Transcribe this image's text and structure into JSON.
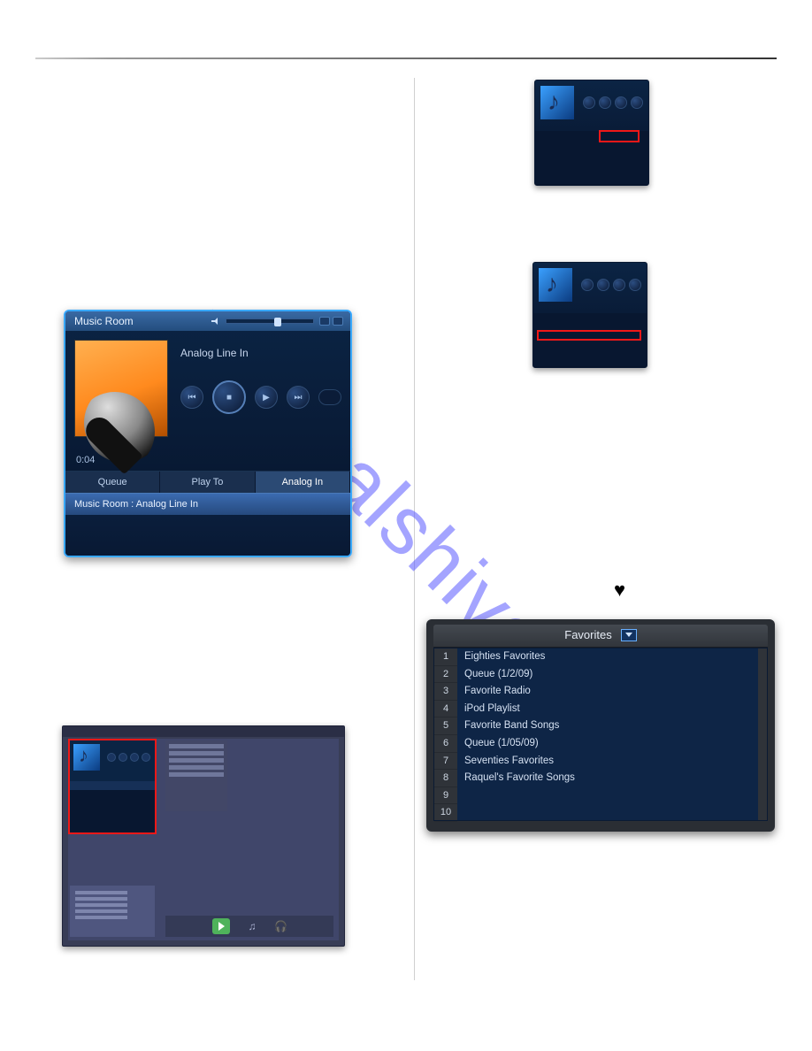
{
  "watermark": "manualshive.co",
  "player": {
    "title": "Music Room",
    "nowPlaying": "Analog Line In",
    "time": "0:04",
    "tabs": {
      "queue": "Queue",
      "playTo": "Play To",
      "analogIn": "Analog In"
    },
    "selectedRow": "Music Room : Analog Line In"
  },
  "favorites": {
    "header": "Favorites",
    "rows": [
      "Eighties Favorites",
      "Queue (1/2/09)",
      "Favorite Radio",
      "iPod Playlist",
      "Favorite Band Songs",
      "Queue (1/05/09)",
      "Seventies Favorites",
      "Raquel's Favorite Songs",
      "",
      ""
    ]
  },
  "icons": {
    "heart": "♥"
  }
}
